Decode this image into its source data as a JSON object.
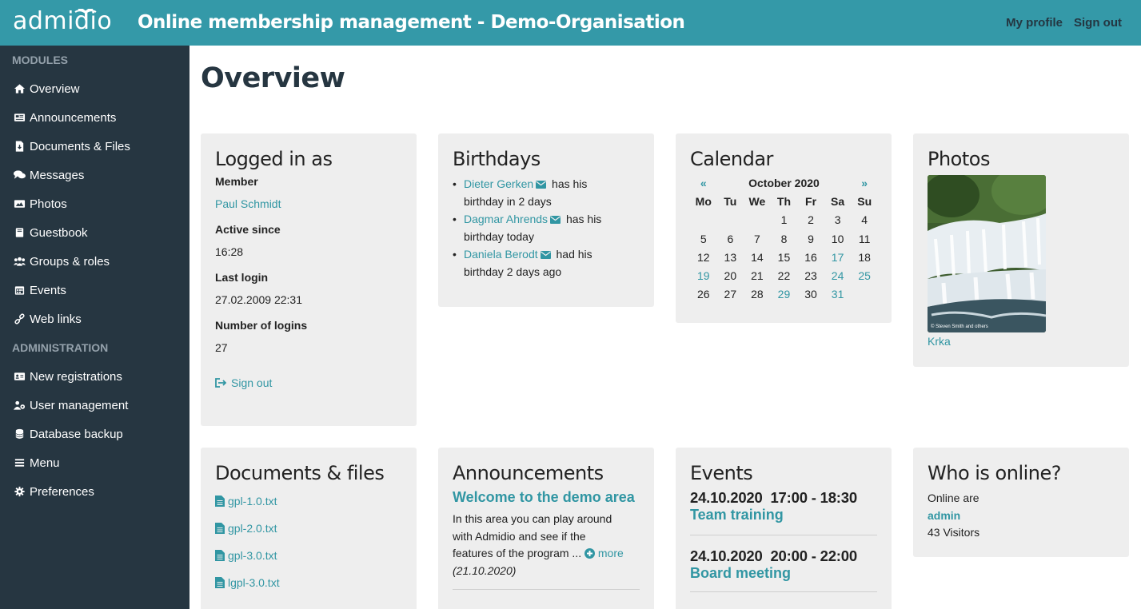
{
  "app": {
    "logo": "admidio",
    "title": "Online membership management - Demo-Organisation",
    "header_links": [
      "My profile",
      "Sign out"
    ]
  },
  "sidebar": {
    "modules_label": "MODULES",
    "modules": [
      {
        "label": "Overview",
        "icon": "home-icon"
      },
      {
        "label": "Announcements",
        "icon": "newspaper-icon"
      },
      {
        "label": "Documents & Files",
        "icon": "file-download-icon"
      },
      {
        "label": "Messages",
        "icon": "comments-icon"
      },
      {
        "label": "Photos",
        "icon": "image-icon"
      },
      {
        "label": "Guestbook",
        "icon": "book-icon"
      },
      {
        "label": "Groups & roles",
        "icon": "users-icon"
      },
      {
        "label": "Events",
        "icon": "calendar-icon"
      },
      {
        "label": "Web links",
        "icon": "link-icon"
      }
    ],
    "admin_label": "ADMINISTRATION",
    "admin": [
      {
        "label": "New registrations",
        "icon": "id-card-icon"
      },
      {
        "label": "User management",
        "icon": "users-cog-icon"
      },
      {
        "label": "Database backup",
        "icon": "database-icon"
      },
      {
        "label": "Menu",
        "icon": "bars-icon"
      },
      {
        "label": "Preferences",
        "icon": "gear-icon"
      }
    ]
  },
  "page": {
    "title": "Overview"
  },
  "login": {
    "title": "Logged in as",
    "member_label": "Member",
    "member_value": "Paul Schmidt",
    "active_label": "Active since",
    "active_value": "16:28",
    "last_login_label": "Last login",
    "last_login_value": "27.02.2009 22:31",
    "num_logins_label": "Number of logins",
    "num_logins_value": "27",
    "signout": "Sign out"
  },
  "birthdays": {
    "title": "Birthdays",
    "items": [
      {
        "name": "Dieter Gerken",
        "text1": "has his",
        "text2": "birthday in 2 days"
      },
      {
        "name": "Dagmar Ahrends",
        "text1": "has his",
        "text2": "birthday today"
      },
      {
        "name": "Daniela Berodt",
        "text1": "had his",
        "text2": "birthday 2 days ago"
      }
    ]
  },
  "calendar": {
    "title": "Calendar",
    "prev": "«",
    "next": "»",
    "month": "October 2020",
    "weekdays": [
      "Mo",
      "Tu",
      "We",
      "Th",
      "Fr",
      "Sa",
      "Su"
    ],
    "weeks": [
      [
        "",
        "",
        "",
        "1",
        "2",
        "3",
        "4"
      ],
      [
        "5",
        "6",
        "7",
        "8",
        "9",
        "10",
        "11"
      ],
      [
        "12",
        "13",
        "14",
        "15",
        "16",
        "17",
        "18"
      ],
      [
        "19",
        "20",
        "21",
        "22",
        "23",
        "24",
        "25"
      ],
      [
        "26",
        "27",
        "28",
        "29",
        "30",
        "31",
        ""
      ]
    ],
    "event_days": [
      "17",
      "19",
      "24",
      "25",
      "29",
      "31"
    ]
  },
  "photos": {
    "title": "Photos",
    "caption": "© Steven Smith and others",
    "album": "Krka"
  },
  "documents": {
    "title": "Documents & files",
    "files": [
      "gpl-1.0.txt",
      "gpl-2.0.txt",
      "gpl-3.0.txt",
      "lgpl-3.0.txt"
    ]
  },
  "announcements": {
    "title": "Announcements",
    "item_title": "Welcome to the demo area",
    "line1": "In this area you can play around",
    "line2": "with Admidio and see if the",
    "line3": "features of the program ...",
    "more": "more",
    "date": "(21.10.2020)"
  },
  "events": {
    "title": "Events",
    "items": [
      {
        "date": "24.10.2020  17:00 - 18:30",
        "title": "Team training"
      },
      {
        "date": "24.10.2020  20:00 - 22:00",
        "title": "Board meeting"
      }
    ]
  },
  "online": {
    "title": "Who is online?",
    "intro": "Online are",
    "user": "admin",
    "visitors": "43 Visitors"
  },
  "colors": {
    "header": "#3499a8",
    "sidebar": "#263641",
    "link": "#3196a3",
    "card": "#eeeeee"
  }
}
